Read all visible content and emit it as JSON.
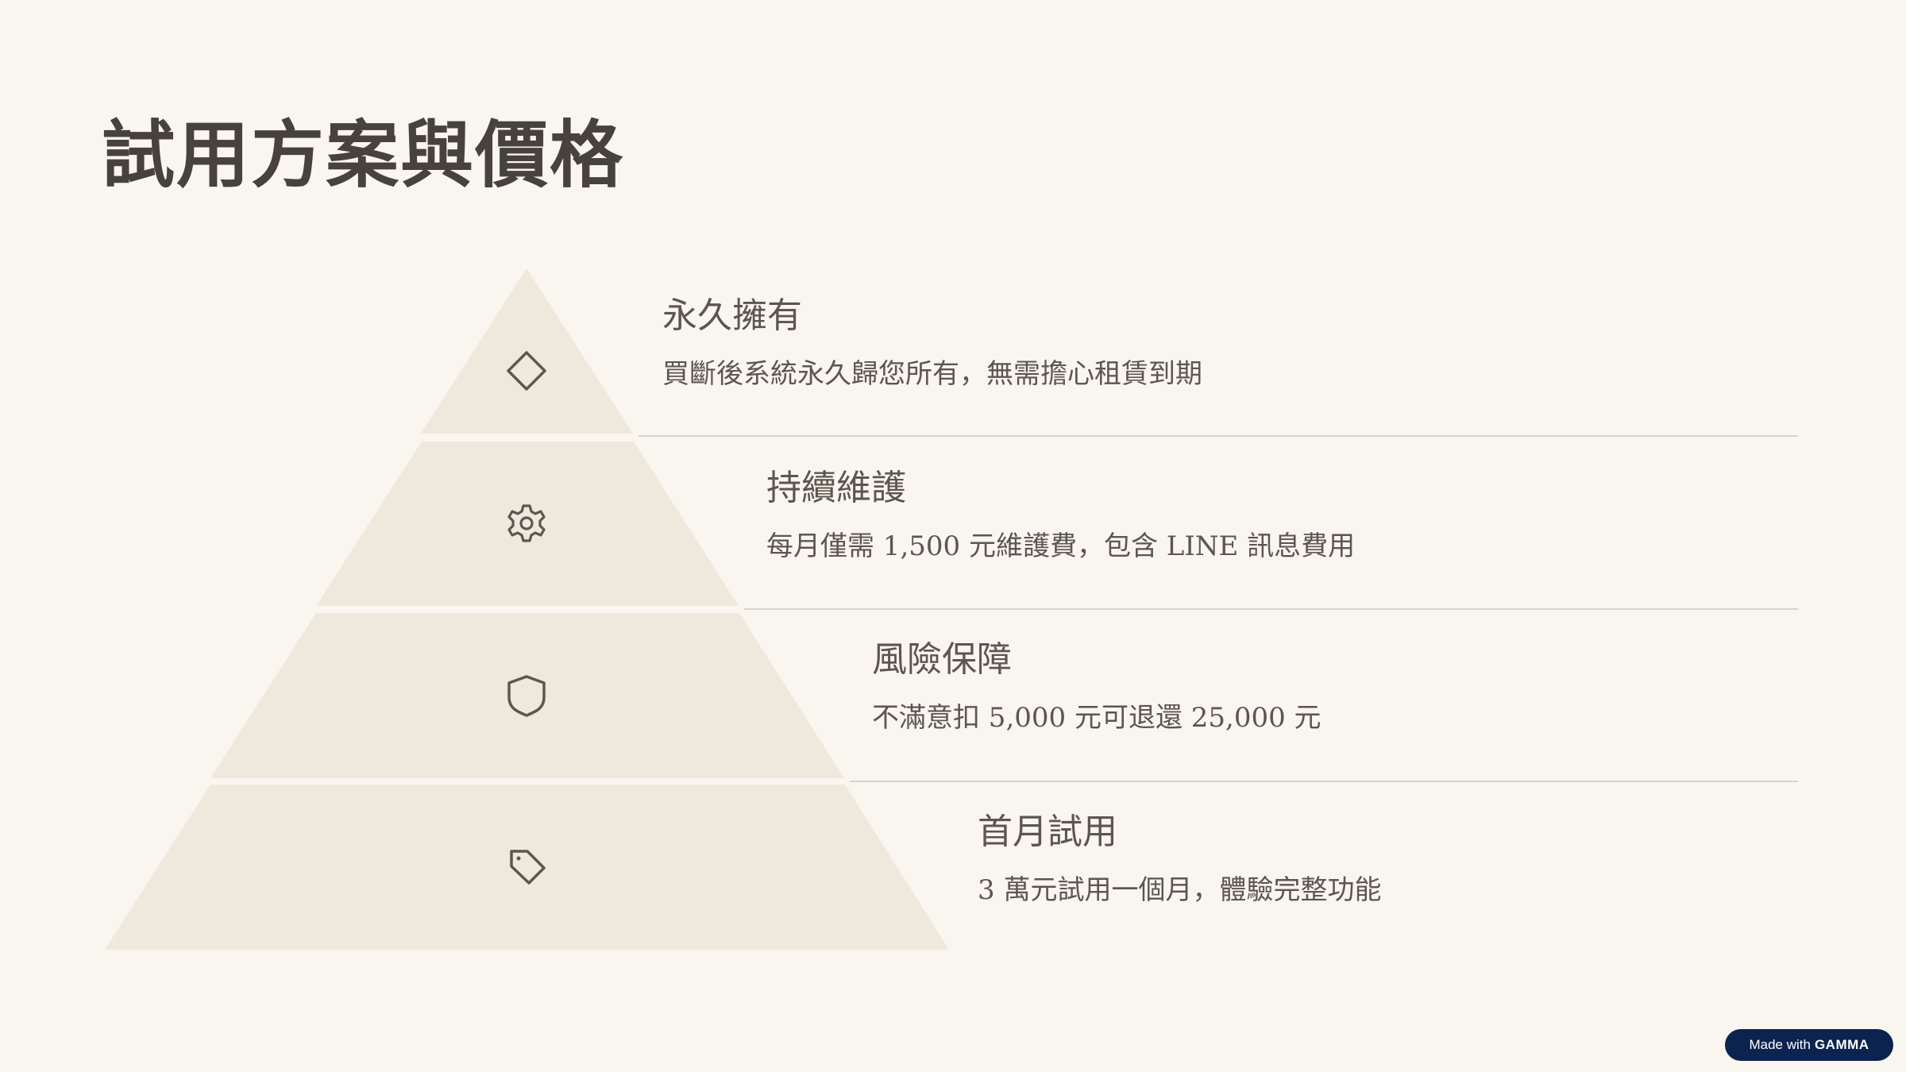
{
  "title": "試用方案與價格",
  "colors": {
    "background": "#f9f6ef",
    "tier_fill": "#efe9dd",
    "divider": "#d9d3c8",
    "icon_stroke": "#5c5850",
    "text": "#4a463f"
  },
  "tiers": [
    {
      "icon": "diamond-icon",
      "heading": "永久擁有",
      "description": "買斷後系統永久歸您所有，無需擔心租賃到期"
    },
    {
      "icon": "gear-icon",
      "heading": "持續維護",
      "description": "每月僅需 1,500 元維護費，包含 LINE 訊息費用"
    },
    {
      "icon": "shield-icon",
      "heading": "風險保障",
      "description": "不滿意扣 5,000 元可退還 25,000 元"
    },
    {
      "icon": "tag-icon",
      "heading": "首月試用",
      "description": "3 萬元試用一個月，體驗完整功能"
    }
  ],
  "badge": {
    "prefix": "Made with",
    "brand": "GAMMA"
  }
}
